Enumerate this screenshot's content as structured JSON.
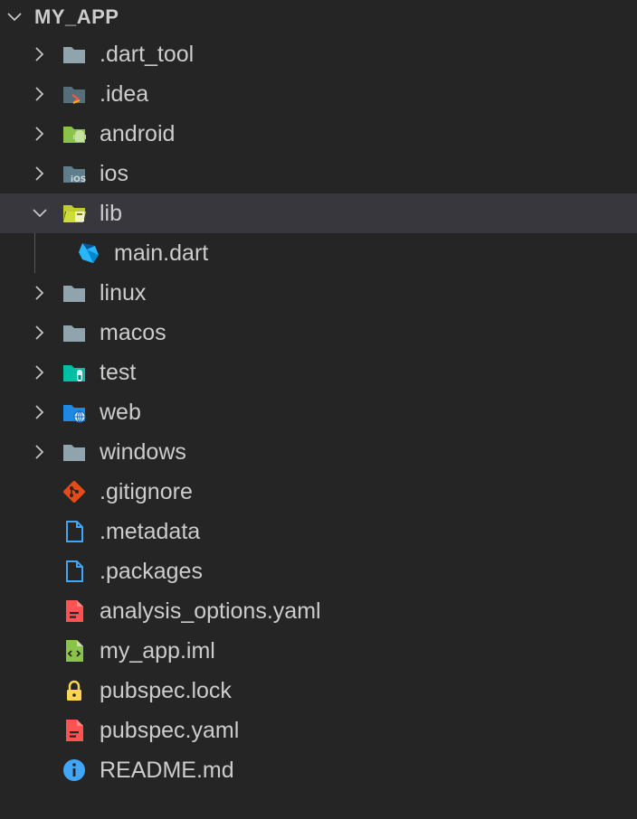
{
  "explorer": {
    "title": "MY_APP",
    "items": [
      {
        "label": ".dart_tool",
        "kind": "folder",
        "icon": "folder-icon",
        "expanded": false
      },
      {
        "label": ".idea",
        "kind": "folder",
        "icon": "idea-folder-icon",
        "expanded": false
      },
      {
        "label": "android",
        "kind": "folder",
        "icon": "android-folder-icon",
        "expanded": false
      },
      {
        "label": "ios",
        "kind": "folder",
        "icon": "ios-folder-icon",
        "expanded": false
      },
      {
        "label": "lib",
        "kind": "folder",
        "icon": "lib-folder-open-icon",
        "expanded": true,
        "selected": true
      },
      {
        "label": "main.dart",
        "kind": "file",
        "icon": "dart-file-icon",
        "indent": 1
      },
      {
        "label": "linux",
        "kind": "folder",
        "icon": "folder-icon",
        "expanded": false
      },
      {
        "label": "macos",
        "kind": "folder",
        "icon": "folder-icon",
        "expanded": false
      },
      {
        "label": "test",
        "kind": "folder",
        "icon": "test-folder-icon",
        "expanded": false
      },
      {
        "label": "web",
        "kind": "folder",
        "icon": "web-folder-icon",
        "expanded": false
      },
      {
        "label": "windows",
        "kind": "folder",
        "icon": "folder-icon",
        "expanded": false
      },
      {
        "label": ".gitignore",
        "kind": "file",
        "icon": "git-icon"
      },
      {
        "label": ".metadata",
        "kind": "file",
        "icon": "file-outline-icon"
      },
      {
        "label": ".packages",
        "kind": "file",
        "icon": "file-outline-icon"
      },
      {
        "label": "analysis_options.yaml",
        "kind": "file",
        "icon": "yaml-file-icon"
      },
      {
        "label": "my_app.iml",
        "kind": "file",
        "icon": "xml-file-icon"
      },
      {
        "label": "pubspec.lock",
        "kind": "file",
        "icon": "lock-icon"
      },
      {
        "label": "pubspec.yaml",
        "kind": "file",
        "icon": "yaml-file-icon"
      },
      {
        "label": "README.md",
        "kind": "file",
        "icon": "info-icon"
      }
    ]
  },
  "colors": {
    "background": "#252526",
    "selected_row": "#37373d",
    "text": "#cccccc",
    "folder_gray": "#90a4ae",
    "android_green": "#8bc34a",
    "test_teal": "#00bfa5",
    "web_blue": "#42a5f5",
    "git_orange": "#e64a19",
    "file_blue": "#42a5f5",
    "yaml_red": "#ff5252",
    "xml_green": "#8bc34a",
    "lock_yellow": "#ffd54f",
    "info_blue": "#42a5f5",
    "lib_yellow": "#cddc39",
    "dart_blue": "#29b6f6"
  }
}
